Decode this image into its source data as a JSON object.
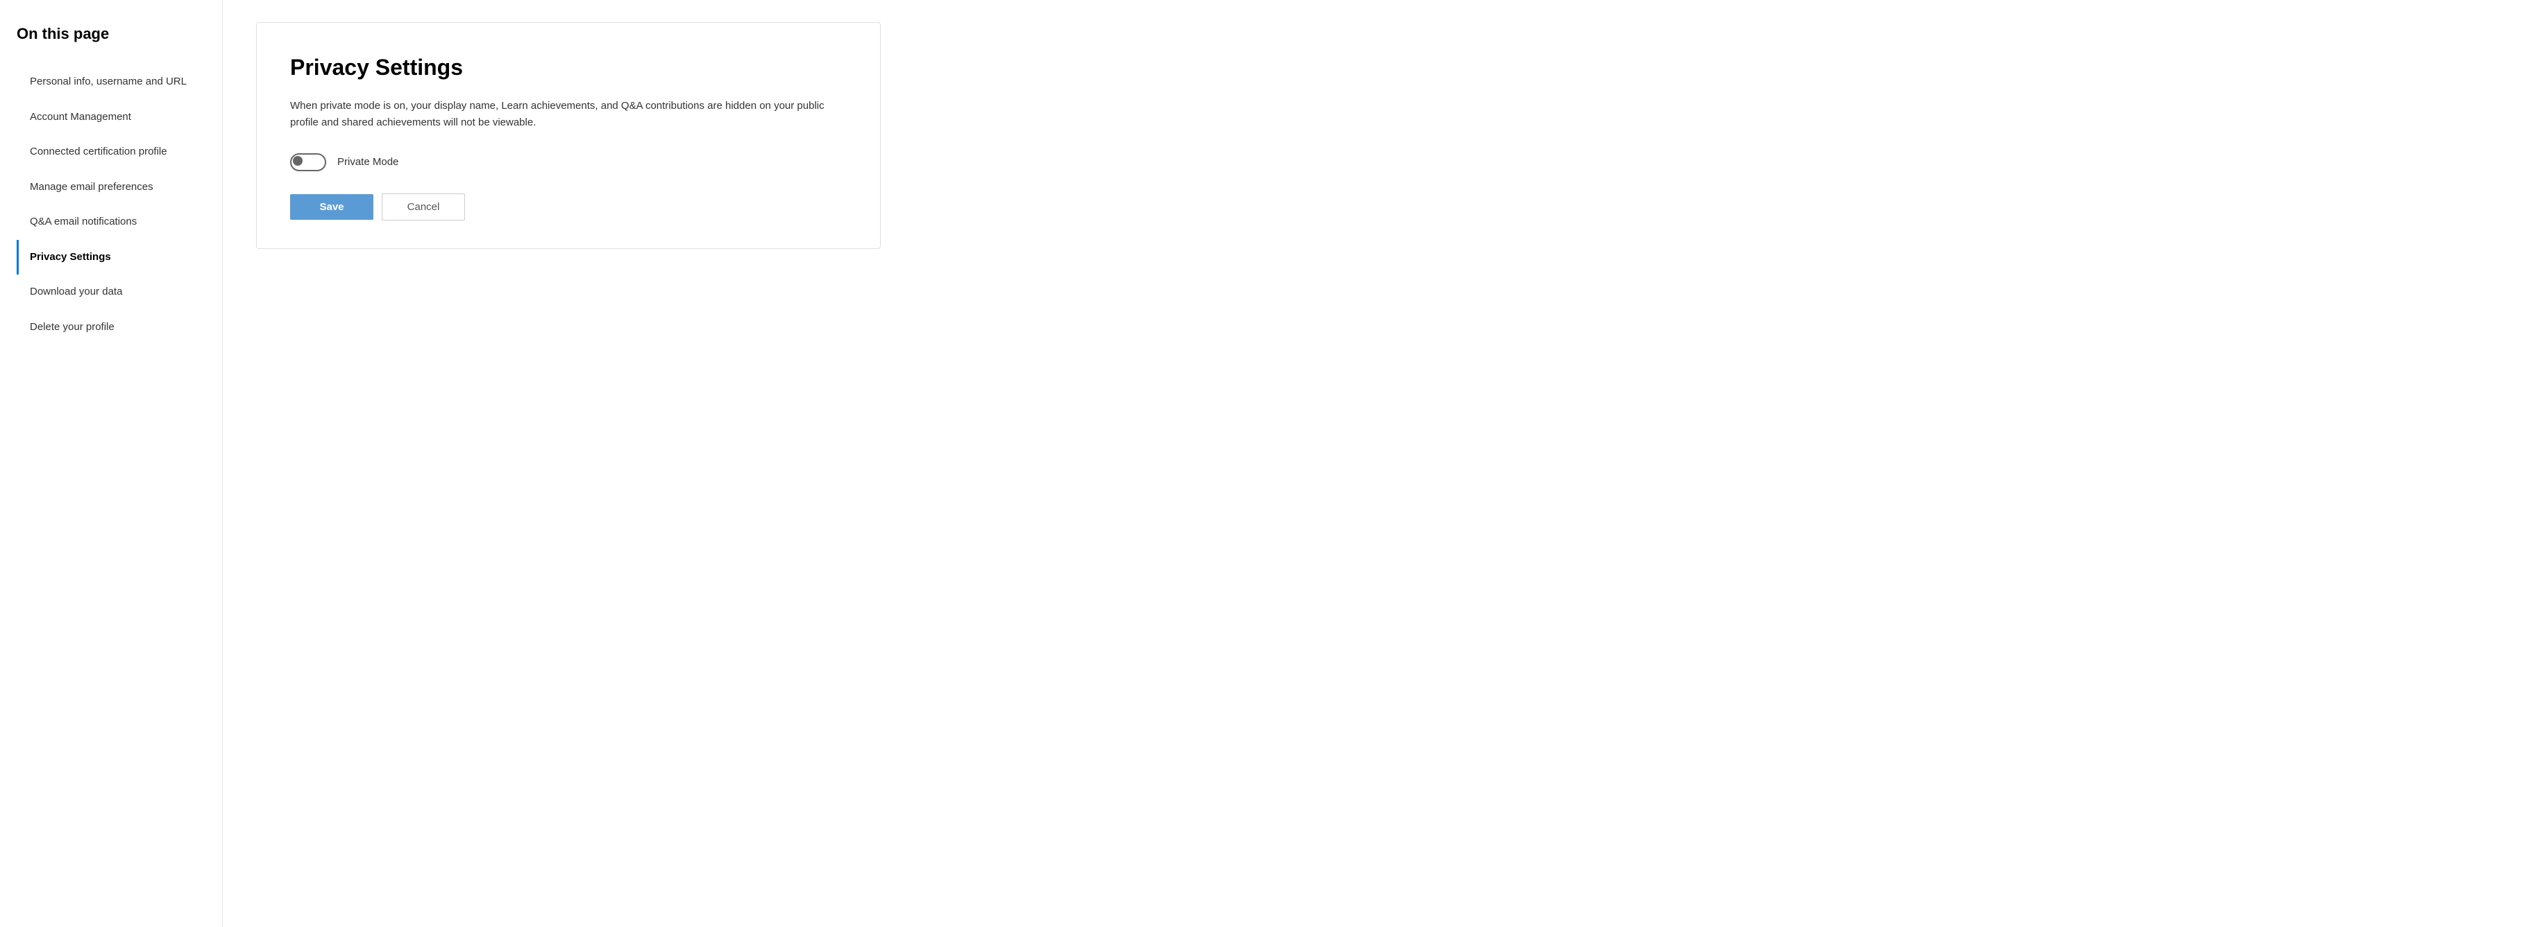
{
  "sidebar": {
    "title": "On this page",
    "items": [
      {
        "id": "personal-info",
        "label": "Personal info, username and URL",
        "active": false
      },
      {
        "id": "account-management",
        "label": "Account Management",
        "active": false
      },
      {
        "id": "connected-cert",
        "label": "Connected certification profile",
        "active": false
      },
      {
        "id": "manage-email",
        "label": "Manage email preferences",
        "active": false
      },
      {
        "id": "qa-email",
        "label": "Q&A email notifications",
        "active": false
      },
      {
        "id": "privacy-settings",
        "label": "Privacy Settings",
        "active": true
      },
      {
        "id": "download-data",
        "label": "Download your data",
        "active": false
      },
      {
        "id": "delete-profile",
        "label": "Delete your profile",
        "active": false
      }
    ]
  },
  "main": {
    "section_title": "Privacy Settings",
    "description": "When private mode is on, your display name, Learn achievements, and Q&A contributions are hidden on your public profile and shared achievements will not be viewable.",
    "toggle_label": "Private Mode",
    "toggle_checked": false,
    "save_label": "Save",
    "cancel_label": "Cancel"
  }
}
